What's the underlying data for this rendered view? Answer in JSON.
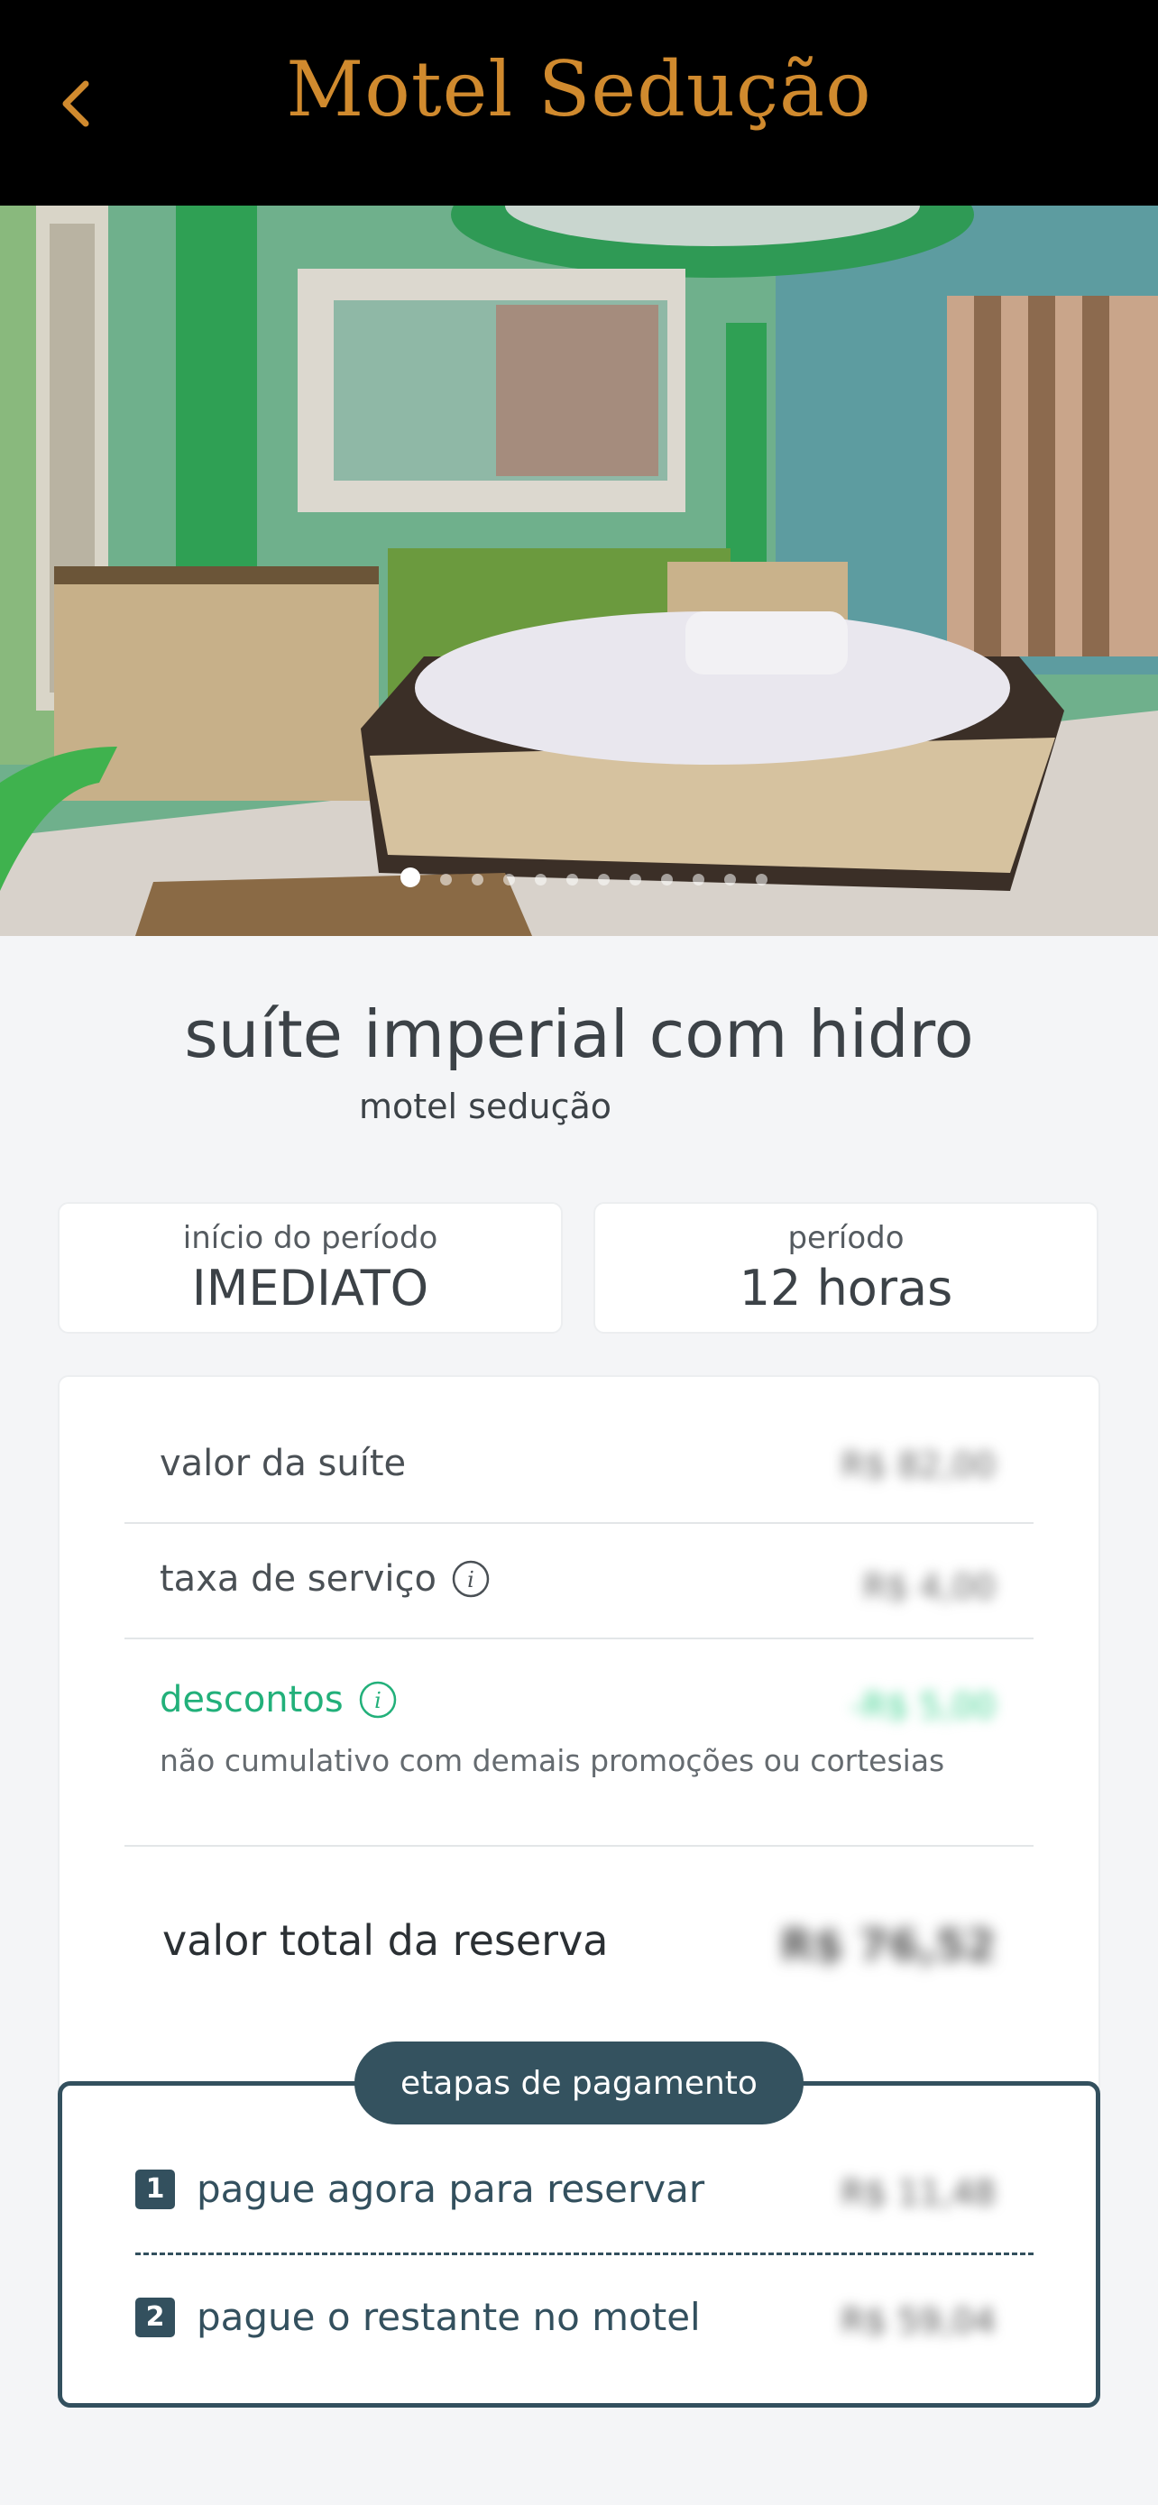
{
  "header": {
    "title": "Motel Sedução",
    "back_icon": "chevron-left-icon",
    "accent_color": "#d08a2e"
  },
  "gallery": {
    "photo_count": 12,
    "active_index": 0
  },
  "suite": {
    "name": "suíte imperial com hidro",
    "motel": "motel sedução"
  },
  "period": {
    "start_label": "início do período",
    "start_value": "IMEDIATO",
    "duration_label": "período",
    "duration_value": "12 horas"
  },
  "pricing": {
    "suite_label": "valor da suíte",
    "suite_value": "R$ 82,00",
    "service_label": "taxa de serviço",
    "service_value": "R$ 4,00",
    "discount_label": "descontos",
    "discount_value": "-R$ 5,00",
    "discount_note": "não cumulativo com demais promoções ou cortesias",
    "total_label": "valor total da reserva",
    "total_value": "R$ 76,52",
    "discount_color": "#22b07a"
  },
  "payment_steps": {
    "title": "etapas de pagamento",
    "steps": [
      {
        "number": "1",
        "label": "pague agora para reservar",
        "value": "R$ 11,48"
      },
      {
        "number": "2",
        "label": "pague o restante no motel",
        "value": "R$ 59,04"
      }
    ],
    "color": "#33505e"
  }
}
